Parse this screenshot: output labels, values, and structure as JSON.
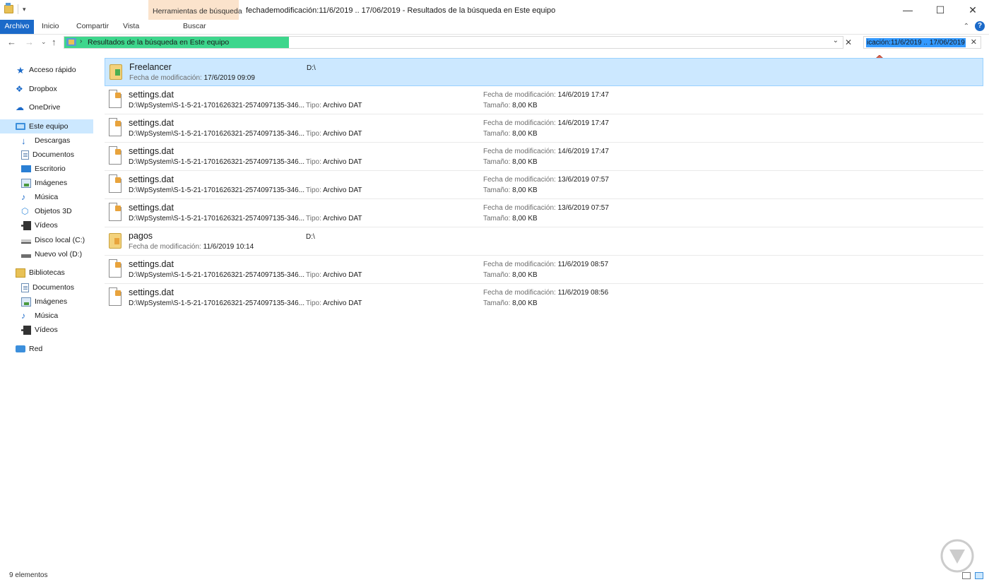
{
  "window": {
    "title": "fechademodificación:11/6/2019 .. 17/06/2019 - Resultados de la búsqueda en Este equipo",
    "context_tab_title": "Herramientas de búsqueda",
    "minimize": "—",
    "maximize": "☐",
    "close": "✕"
  },
  "ribbon": {
    "tabs": [
      "Archivo",
      "Inicio",
      "Compartir",
      "Vista",
      "Buscar"
    ],
    "collapse": "⌃",
    "help": "?"
  },
  "address": {
    "path": "Resultados de la búsqueda en Este equipo",
    "separator": "›",
    "dropdown": "⌄",
    "clear": "✕"
  },
  "search": {
    "query_visible": "icación:11/6/2019 .. 17/06/2019",
    "clear": "✕"
  },
  "nav_buttons": {
    "back": "←",
    "forward": "→",
    "recent": "⌄",
    "up": "↑"
  },
  "sidebar": {
    "items": [
      {
        "label": "Acceso rápido",
        "icon": "star-icon"
      },
      {
        "label": "Dropbox",
        "icon": "dropbox-icon"
      },
      {
        "label": "OneDrive",
        "icon": "cloud-icon"
      },
      {
        "label": "Este equipo",
        "icon": "computer-icon"
      },
      {
        "label": "Descargas",
        "icon": "download-icon"
      },
      {
        "label": "Documentos",
        "icon": "documents-icon"
      },
      {
        "label": "Escritorio",
        "icon": "desktop-icon"
      },
      {
        "label": "Imágenes",
        "icon": "pictures-icon"
      },
      {
        "label": "Música",
        "icon": "music-icon"
      },
      {
        "label": "Objetos 3D",
        "icon": "objects-3d-icon"
      },
      {
        "label": "Vídeos",
        "icon": "videos-icon"
      },
      {
        "label": "Disco local (C:)",
        "icon": "local-disk-icon"
      },
      {
        "label": "Nuevo vol (D:)",
        "icon": "drive-icon"
      },
      {
        "label": "Bibliotecas",
        "icon": "libraries-icon"
      },
      {
        "label": "Documentos",
        "icon": "documents-icon"
      },
      {
        "label": "Imágenes",
        "icon": "pictures-icon"
      },
      {
        "label": "Música",
        "icon": "music-icon"
      },
      {
        "label": "Vídeos",
        "icon": "videos-icon"
      },
      {
        "label": "Red",
        "icon": "network-icon"
      }
    ]
  },
  "labels": {
    "fecha_mod": "Fecha de modificación:",
    "tipo": "Tipo:",
    "tamano": "Tamaño:"
  },
  "results": [
    {
      "name": "Freelancer",
      "kind": "folder",
      "modified": "17/6/2019 09:09",
      "location": "D:\\"
    },
    {
      "name": "settings.dat",
      "kind": "file",
      "path": "D:\\WpSystem\\S-1-5-21-1701626321-2574097135-346...",
      "type": "Archivo DAT",
      "modified": "14/6/2019 17:47",
      "size": "8,00 KB"
    },
    {
      "name": "settings.dat",
      "kind": "file",
      "path": "D:\\WpSystem\\S-1-5-21-1701626321-2574097135-346...",
      "type": "Archivo DAT",
      "modified": "14/6/2019 17:47",
      "size": "8,00 KB"
    },
    {
      "name": "settings.dat",
      "kind": "file",
      "path": "D:\\WpSystem\\S-1-5-21-1701626321-2574097135-346...",
      "type": "Archivo DAT",
      "modified": "14/6/2019 17:47",
      "size": "8,00 KB"
    },
    {
      "name": "settings.dat",
      "kind": "file",
      "path": "D:\\WpSystem\\S-1-5-21-1701626321-2574097135-346...",
      "type": "Archivo DAT",
      "modified": "13/6/2019 07:57",
      "size": "8,00 KB"
    },
    {
      "name": "settings.dat",
      "kind": "file",
      "path": "D:\\WpSystem\\S-1-5-21-1701626321-2574097135-346...",
      "type": "Archivo DAT",
      "modified": "13/6/2019 07:57",
      "size": "8,00 KB"
    },
    {
      "name": "pagos",
      "kind": "folder",
      "modified": "11/6/2019 10:14",
      "location": "D:\\"
    },
    {
      "name": "settings.dat",
      "kind": "file",
      "path": "D:\\WpSystem\\S-1-5-21-1701626321-2574097135-346...",
      "type": "Archivo DAT",
      "modified": "11/6/2019 08:57",
      "size": "8,00 KB"
    },
    {
      "name": "settings.dat",
      "kind": "file",
      "path": "D:\\WpSystem\\S-1-5-21-1701626321-2574097135-346...",
      "type": "Archivo DAT",
      "modified": "11/6/2019 08:56",
      "size": "8,00 KB"
    }
  ],
  "status": {
    "count": "9 elementos"
  },
  "colors": {
    "accent": "#1b6ac9",
    "selection": "#cce8ff",
    "address_highlight": "#3dd68c",
    "search_highlight": "#3399ff",
    "context_tab": "#fbe3cc",
    "arrow": "#d9634f"
  }
}
